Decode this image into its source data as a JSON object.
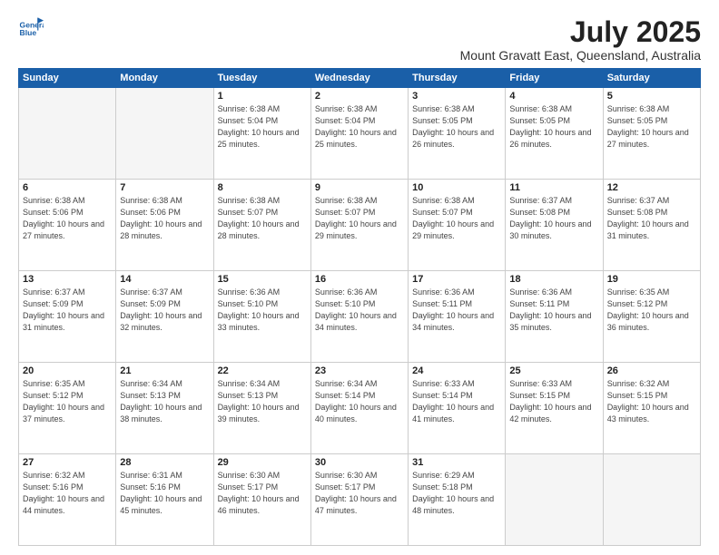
{
  "header": {
    "logo_line1": "General",
    "logo_line2": "Blue",
    "month": "July 2025",
    "location": "Mount Gravatt East, Queensland, Australia"
  },
  "weekdays": [
    "Sunday",
    "Monday",
    "Tuesday",
    "Wednesday",
    "Thursday",
    "Friday",
    "Saturday"
  ],
  "weeks": [
    [
      {
        "day": "",
        "info": ""
      },
      {
        "day": "",
        "info": ""
      },
      {
        "day": "1",
        "info": "Sunrise: 6:38 AM\nSunset: 5:04 PM\nDaylight: 10 hours\nand 25 minutes."
      },
      {
        "day": "2",
        "info": "Sunrise: 6:38 AM\nSunset: 5:04 PM\nDaylight: 10 hours\nand 25 minutes."
      },
      {
        "day": "3",
        "info": "Sunrise: 6:38 AM\nSunset: 5:05 PM\nDaylight: 10 hours\nand 26 minutes."
      },
      {
        "day": "4",
        "info": "Sunrise: 6:38 AM\nSunset: 5:05 PM\nDaylight: 10 hours\nand 26 minutes."
      },
      {
        "day": "5",
        "info": "Sunrise: 6:38 AM\nSunset: 5:05 PM\nDaylight: 10 hours\nand 27 minutes."
      }
    ],
    [
      {
        "day": "6",
        "info": "Sunrise: 6:38 AM\nSunset: 5:06 PM\nDaylight: 10 hours\nand 27 minutes."
      },
      {
        "day": "7",
        "info": "Sunrise: 6:38 AM\nSunset: 5:06 PM\nDaylight: 10 hours\nand 28 minutes."
      },
      {
        "day": "8",
        "info": "Sunrise: 6:38 AM\nSunset: 5:07 PM\nDaylight: 10 hours\nand 28 minutes."
      },
      {
        "day": "9",
        "info": "Sunrise: 6:38 AM\nSunset: 5:07 PM\nDaylight: 10 hours\nand 29 minutes."
      },
      {
        "day": "10",
        "info": "Sunrise: 6:38 AM\nSunset: 5:07 PM\nDaylight: 10 hours\nand 29 minutes."
      },
      {
        "day": "11",
        "info": "Sunrise: 6:37 AM\nSunset: 5:08 PM\nDaylight: 10 hours\nand 30 minutes."
      },
      {
        "day": "12",
        "info": "Sunrise: 6:37 AM\nSunset: 5:08 PM\nDaylight: 10 hours\nand 31 minutes."
      }
    ],
    [
      {
        "day": "13",
        "info": "Sunrise: 6:37 AM\nSunset: 5:09 PM\nDaylight: 10 hours\nand 31 minutes."
      },
      {
        "day": "14",
        "info": "Sunrise: 6:37 AM\nSunset: 5:09 PM\nDaylight: 10 hours\nand 32 minutes."
      },
      {
        "day": "15",
        "info": "Sunrise: 6:36 AM\nSunset: 5:10 PM\nDaylight: 10 hours\nand 33 minutes."
      },
      {
        "day": "16",
        "info": "Sunrise: 6:36 AM\nSunset: 5:10 PM\nDaylight: 10 hours\nand 34 minutes."
      },
      {
        "day": "17",
        "info": "Sunrise: 6:36 AM\nSunset: 5:11 PM\nDaylight: 10 hours\nand 34 minutes."
      },
      {
        "day": "18",
        "info": "Sunrise: 6:36 AM\nSunset: 5:11 PM\nDaylight: 10 hours\nand 35 minutes."
      },
      {
        "day": "19",
        "info": "Sunrise: 6:35 AM\nSunset: 5:12 PM\nDaylight: 10 hours\nand 36 minutes."
      }
    ],
    [
      {
        "day": "20",
        "info": "Sunrise: 6:35 AM\nSunset: 5:12 PM\nDaylight: 10 hours\nand 37 minutes."
      },
      {
        "day": "21",
        "info": "Sunrise: 6:34 AM\nSunset: 5:13 PM\nDaylight: 10 hours\nand 38 minutes."
      },
      {
        "day": "22",
        "info": "Sunrise: 6:34 AM\nSunset: 5:13 PM\nDaylight: 10 hours\nand 39 minutes."
      },
      {
        "day": "23",
        "info": "Sunrise: 6:34 AM\nSunset: 5:14 PM\nDaylight: 10 hours\nand 40 minutes."
      },
      {
        "day": "24",
        "info": "Sunrise: 6:33 AM\nSunset: 5:14 PM\nDaylight: 10 hours\nand 41 minutes."
      },
      {
        "day": "25",
        "info": "Sunrise: 6:33 AM\nSunset: 5:15 PM\nDaylight: 10 hours\nand 42 minutes."
      },
      {
        "day": "26",
        "info": "Sunrise: 6:32 AM\nSunset: 5:15 PM\nDaylight: 10 hours\nand 43 minutes."
      }
    ],
    [
      {
        "day": "27",
        "info": "Sunrise: 6:32 AM\nSunset: 5:16 PM\nDaylight: 10 hours\nand 44 minutes."
      },
      {
        "day": "28",
        "info": "Sunrise: 6:31 AM\nSunset: 5:16 PM\nDaylight: 10 hours\nand 45 minutes."
      },
      {
        "day": "29",
        "info": "Sunrise: 6:30 AM\nSunset: 5:17 PM\nDaylight: 10 hours\nand 46 minutes."
      },
      {
        "day": "30",
        "info": "Sunrise: 6:30 AM\nSunset: 5:17 PM\nDaylight: 10 hours\nand 47 minutes."
      },
      {
        "day": "31",
        "info": "Sunrise: 6:29 AM\nSunset: 5:18 PM\nDaylight: 10 hours\nand 48 minutes."
      },
      {
        "day": "",
        "info": ""
      },
      {
        "day": "",
        "info": ""
      }
    ]
  ]
}
